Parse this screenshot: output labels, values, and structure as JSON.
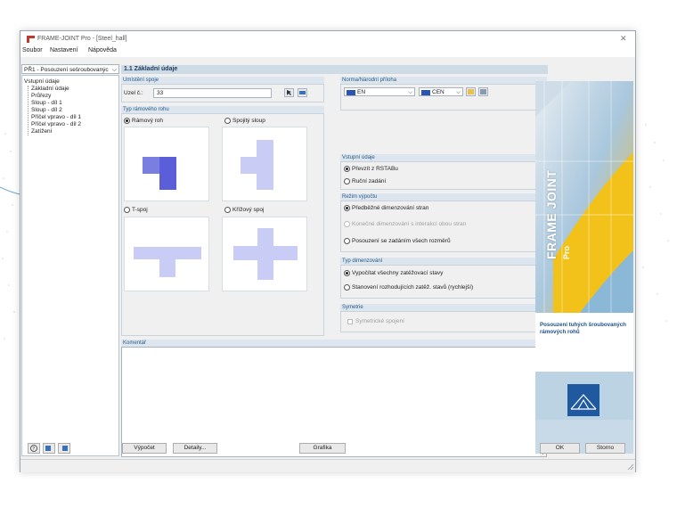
{
  "window": {
    "title": "FRAME-JOINT Pro - [Steel_hall]"
  },
  "menu": {
    "items": [
      "Soubor",
      "Nastavení",
      "Nápověda"
    ]
  },
  "case_selector": {
    "value": "PŘ1 - Posouzení sešroubovanýc"
  },
  "tree": {
    "root": "Vstupní údaje",
    "items": [
      "Základní údaje",
      "Průřezy",
      "Sloup - díl 1",
      "Sloup - díl 2",
      "Příčel vpravo - díl 1",
      "Příčel vpravo - díl 2",
      "Zatížení"
    ]
  },
  "page_header": "1.1 Základní údaje",
  "joint_location": {
    "title": "Umístění spoje",
    "node_label": "Uzel č.:",
    "node_value": "33"
  },
  "frame_corner_type": {
    "title": "Typ rámového rohu",
    "options": [
      {
        "label": "Rámový roh",
        "selected": true
      },
      {
        "label": "Spojitý sloup",
        "selected": false
      },
      {
        "label": "T-spoj",
        "selected": false
      },
      {
        "label": "Křížový spoj",
        "selected": false
      }
    ]
  },
  "standard": {
    "title": "Norma/Národní příloha",
    "norm": "EN",
    "annex": "CEN"
  },
  "input_data": {
    "title": "Vstupní údaje",
    "options": [
      {
        "label": "Převzít z RSTABu",
        "selected": true
      },
      {
        "label": "Ruční zadání",
        "selected": false
      }
    ]
  },
  "calc_mode": {
    "title": "Režim výpočtu",
    "options": [
      {
        "label": "Předběžné dimenzování stran",
        "selected": true,
        "disabled": false
      },
      {
        "label": "Konečné dimenzování s interakcí obou stran",
        "selected": false,
        "disabled": true
      },
      {
        "label": "Posouzení se zadáním všech rozměrů",
        "selected": false,
        "disabled": false
      }
    ]
  },
  "design_type": {
    "title": "Typ dimenzování",
    "options": [
      {
        "label": "Vypočítat všechny zatěžovací stavy",
        "selected": true
      },
      {
        "label": "Stanovení rozhodujících zatěž. stavů (rychlejší)",
        "selected": false
      }
    ]
  },
  "symmetry": {
    "title": "Symetrie",
    "checkbox_label": "Symetrické spojení",
    "checked": false
  },
  "comment": {
    "title": "Komentář",
    "value": ""
  },
  "banner": {
    "brand": "FRAME JOINT",
    "sub": "Pro",
    "description": "Posouzení tuhých šroubovaných rámových rohů"
  },
  "buttons": {
    "calc": "Výpočet",
    "details": "Detaily...",
    "graphics": "Grafika",
    "ok": "OK",
    "cancel": "Storno"
  },
  "colors": {
    "accent": "#2a5a8a",
    "header_bg": "#cddbe7",
    "shape_fill": "#7a7ee0",
    "shape_light": "#c9cdf5",
    "banner_yellow": "#f2c21a"
  }
}
